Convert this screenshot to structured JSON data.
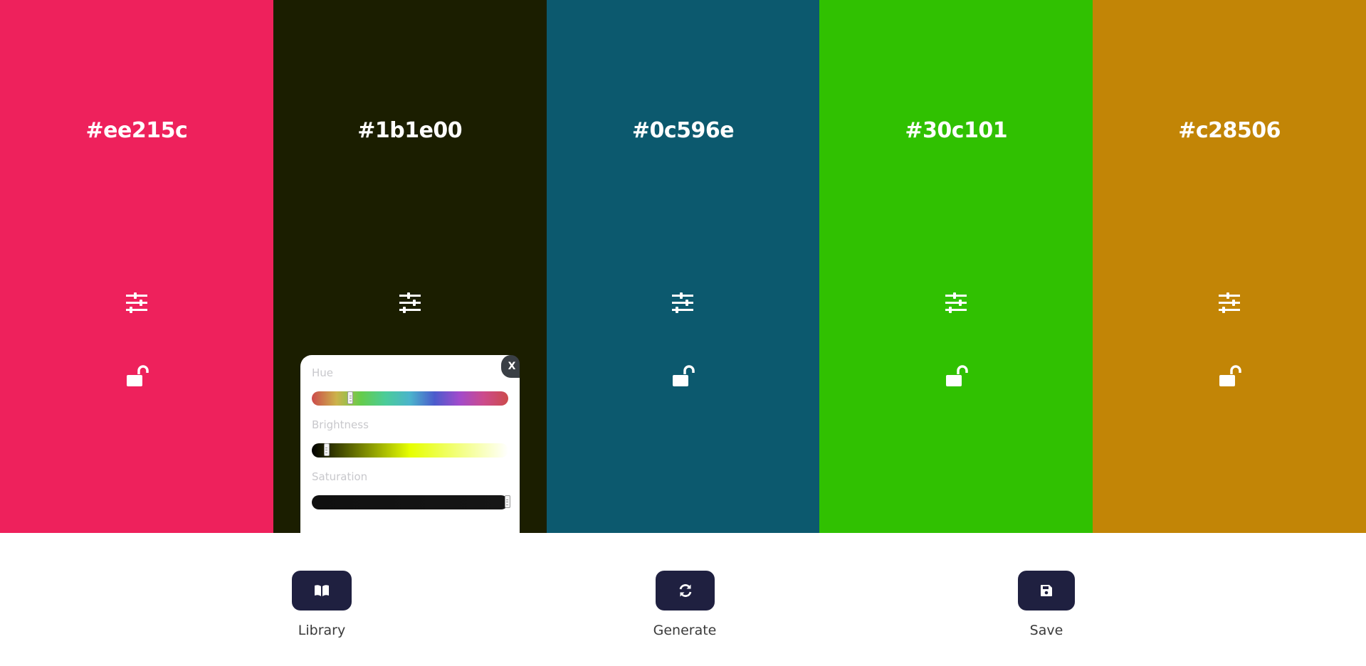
{
  "colors": [
    {
      "hex": "#ee215c",
      "bg": "#ee215c"
    },
    {
      "hex": "#1b1e00",
      "bg": "#1b1e00"
    },
    {
      "hex": "#0c596e",
      "bg": "#0c596e"
    },
    {
      "hex": "#30c101",
      "bg": "#30c101"
    },
    {
      "hex": "#c28506",
      "bg": "#c28506"
    }
  ],
  "sliders": {
    "close_label": "X",
    "hue_label": "Hue",
    "brightness_label": "Brightness",
    "saturation_label": "Saturation",
    "hue_value": 0.196,
    "brightness_value": 0.075,
    "saturation_value": 0.995
  },
  "panel": {
    "library_label": "Library",
    "generate_label": "Generate",
    "save_label": "Save",
    "button_color": "#1f2040"
  }
}
